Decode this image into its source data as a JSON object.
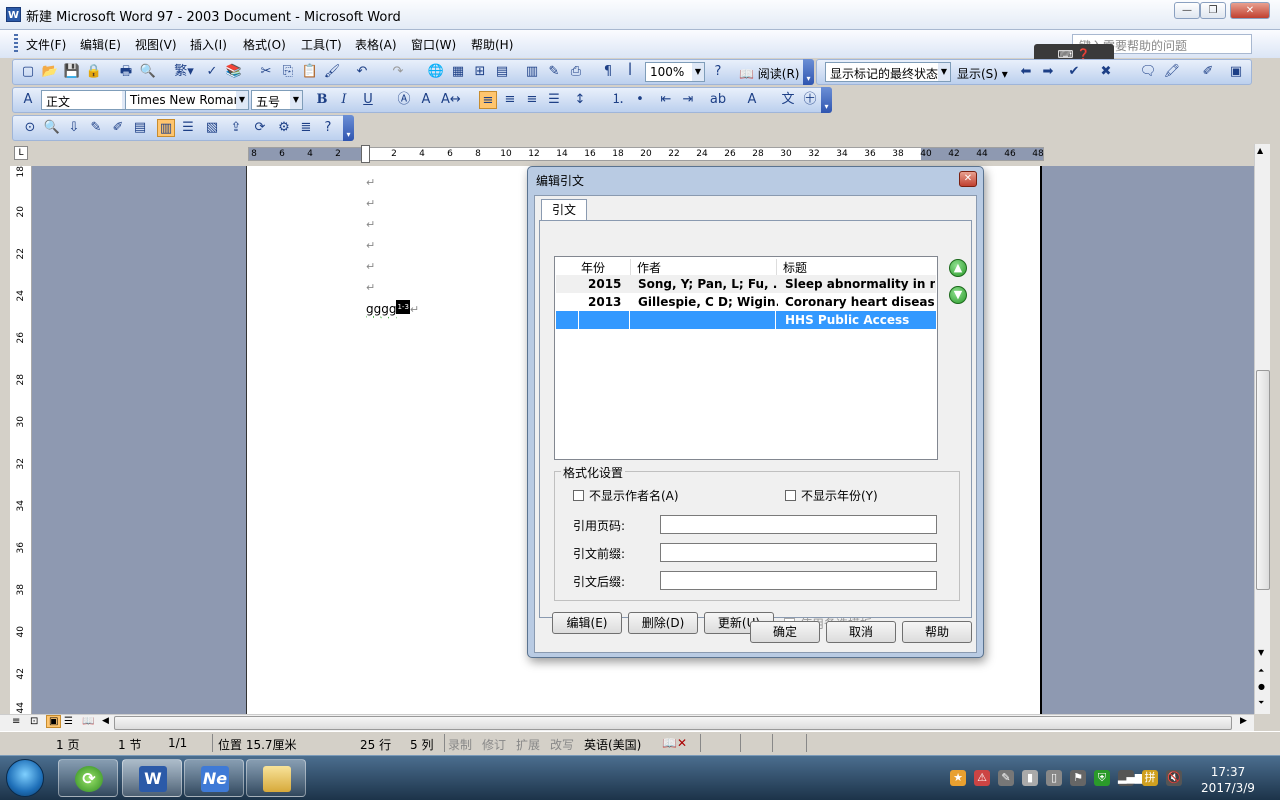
{
  "window": {
    "title": "新建 Microsoft Word 97 - 2003 Document - Microsoft Word",
    "app_icon": "W"
  },
  "menubar": {
    "items": [
      "文件(F)",
      "编辑(E)",
      "视图(V)",
      "插入(I)",
      "格式(O)",
      "工具(T)",
      "表格(A)",
      "窗口(W)",
      "帮助(H)"
    ],
    "help_placeholder": "键入需要帮助的问题"
  },
  "toolbar1": {
    "trad_simplified": "繁",
    "zoom": "100%",
    "reading": "阅读(R)",
    "markup_state": "显示标记的最终状态",
    "show": "显示(S)"
  },
  "toolbar2": {
    "style": "正文",
    "font": "Times New Roman",
    "size": "五号",
    "bold": "B",
    "italic": "I",
    "underline": "U"
  },
  "ruler": {
    "h_ticks": [
      "8",
      "6",
      "4",
      "2",
      "2",
      "4",
      "6",
      "8",
      "10",
      "12",
      "14",
      "16",
      "18",
      "20",
      "22",
      "24",
      "26",
      "28",
      "30",
      "32",
      "34",
      "36",
      "38",
      "40",
      "42",
      "44",
      "46",
      "48"
    ],
    "v_ticks": [
      "18",
      "20",
      "22",
      "24",
      "26",
      "28",
      "30",
      "32",
      "34",
      "36",
      "38",
      "40",
      "42",
      "44"
    ]
  },
  "document": {
    "para_mark": "↵",
    "text": "gggg",
    "citation_field": "1-3"
  },
  "statusbar": {
    "page": "1 页",
    "section": "1 节",
    "pages": "1/1",
    "position": "位置 15.7厘米",
    "line": "25 行",
    "col": "5 列",
    "rec": "录制",
    "trk": "修订",
    "ext": "扩展",
    "ovr": "改写",
    "lang": "英语(美国)"
  },
  "dialog": {
    "title": "编辑引文",
    "tab": "引文",
    "columns": [
      "年份",
      "作者",
      "标题"
    ],
    "rows": [
      {
        "year": "2015",
        "author": "Song, Y; Pan, L; Fu, ..",
        "title": "Sleep abnormality in n"
      },
      {
        "year": "2013",
        "author": "Gillespie, C D; Wigin.",
        "title": "Coronary heart disease"
      },
      {
        "year": "",
        "author": "",
        "title": "HHS Public Access"
      }
    ],
    "format_group": "格式化设置",
    "hide_author": "不显示作者名(A)",
    "hide_year": "不显示年份(Y)",
    "pages_label": "引用页码:",
    "prefix_label": "引文前缀:",
    "suffix_label": "引文后缀:",
    "pages_value": "",
    "prefix_value": "",
    "suffix_value": "",
    "edit_btn": "编辑(E)",
    "delete_btn": "删除(D)",
    "update_btn": "更新(U)",
    "alt_template": "使用备选模板",
    "ok_btn": "确定",
    "cancel_btn": "取消",
    "help_btn": "帮助"
  },
  "taskbar": {
    "time": "17:37",
    "date": "2017/3/9"
  }
}
